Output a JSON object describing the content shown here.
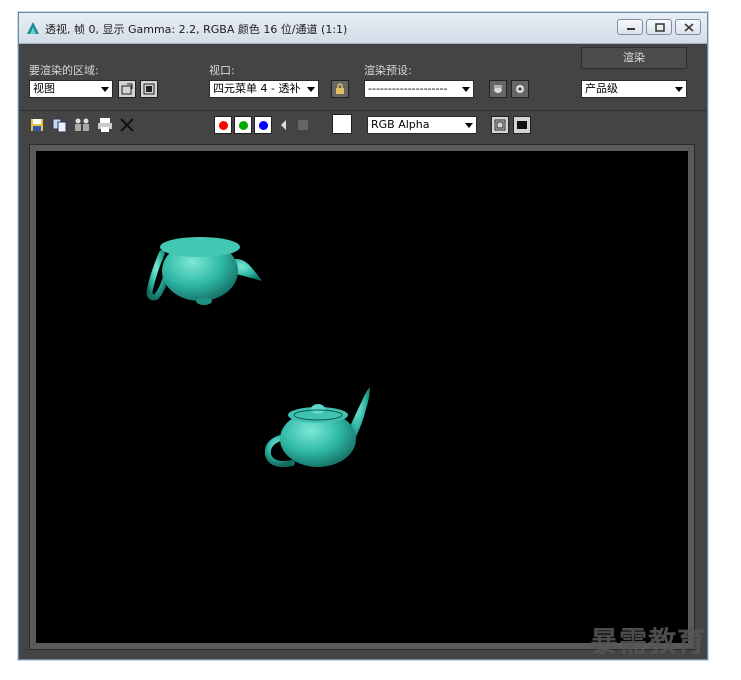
{
  "window": {
    "title": "透视, 帧 0, 显示 Gamma: 2.2, RGBA 颜色 16 位/通道 (1:1)",
    "controls": [
      "minimize-icon",
      "maximize-icon",
      "close-icon"
    ]
  },
  "toolbar": {
    "area_label": "要渲染的区域:",
    "area_value": "视图",
    "viewport_label": "视口:",
    "viewport_value": "四元菜单 4 - 透补",
    "preset_label": "渲染预设:",
    "preset_value": "--------------------",
    "render_button": "渲染",
    "quality_value": "产品级",
    "channel_value": "RGB Alpha"
  },
  "colors": {
    "red_channel": "#ff0000",
    "green_channel": "#00aa00",
    "blue_channel": "#0000ff",
    "viewport_bg": "#000000",
    "teapot": "#2fb9a6"
  },
  "watermark": "暴需教育"
}
